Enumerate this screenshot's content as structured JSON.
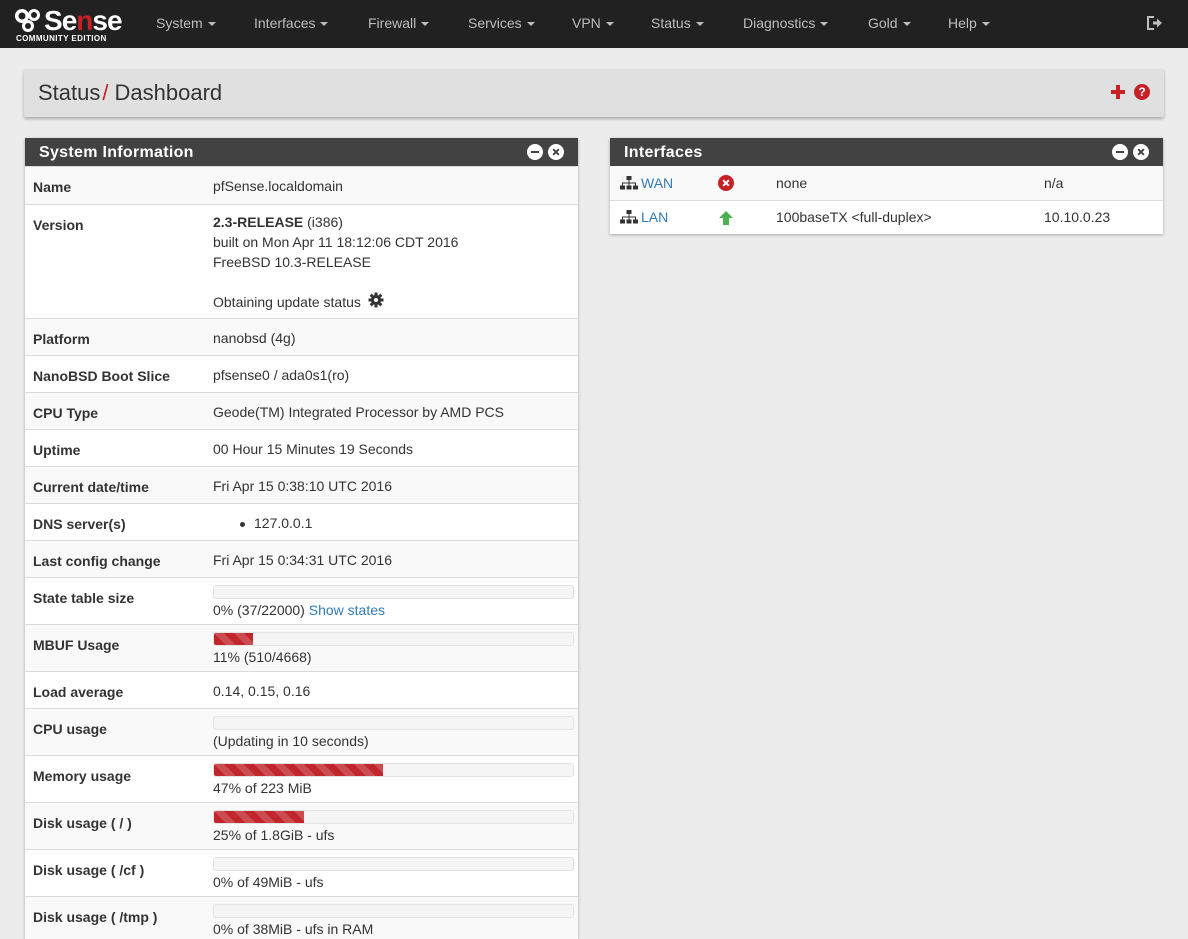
{
  "navbar": {
    "logo": {
      "text_main": "Sense",
      "text_sub": "COMMUNITY EDITION"
    },
    "menu": [
      {
        "label": "System"
      },
      {
        "label": "Interfaces"
      },
      {
        "label": "Firewall"
      },
      {
        "label": "Services"
      },
      {
        "label": "VPN"
      },
      {
        "label": "Status"
      },
      {
        "label": "Diagnostics"
      },
      {
        "label": "Gold"
      },
      {
        "label": "Help"
      }
    ],
    "logout_icon": "sign-out-icon"
  },
  "breadcrumb": {
    "section": "Status",
    "separator": "/",
    "page": "Dashboard",
    "icons": [
      "plus-icon",
      "question-circle-icon"
    ],
    "help_glyph": "?"
  },
  "system_info": {
    "title": "System Information",
    "rows": {
      "name": {
        "label": "Name",
        "value": "pfSense.localdomain"
      },
      "version": {
        "label": "Version",
        "release": "2.3-RELEASE",
        "arch": " (i386)",
        "built": "built on Mon Apr 11 18:12:06 CDT 2016",
        "os": "FreeBSD 10.3-RELEASE",
        "update_status": "Obtaining update status"
      },
      "platform": {
        "label": "Platform",
        "value": "nanobsd (4g)"
      },
      "boot_slice": {
        "label": "NanoBSD Boot Slice",
        "value": "pfsense0 / ada0s1(ro)"
      },
      "cpu_type": {
        "label": "CPU Type",
        "value": "Geode(TM) Integrated Processor by AMD PCS"
      },
      "uptime": {
        "label": "Uptime",
        "value": "00 Hour 15 Minutes 19 Seconds"
      },
      "datetime": {
        "label": "Current date/time",
        "value": "Fri Apr 15 0:38:10 UTC 2016"
      },
      "dns": {
        "label": "DNS server(s)",
        "servers": [
          "127.0.0.1"
        ]
      },
      "last_config": {
        "label": "Last config change",
        "value": "Fri Apr 15 0:34:31 UTC 2016"
      },
      "state_table": {
        "label": "State table size",
        "percent": 0,
        "value": "0% (37/22000)",
        "link": "Show states"
      },
      "mbuf": {
        "label": "MBUF Usage",
        "percent": 11,
        "value": "11% (510/4668)"
      },
      "load": {
        "label": "Load average",
        "value": "0.14, 0.15, 0.16"
      },
      "cpu_usage": {
        "label": "CPU usage",
        "percent": 0,
        "value": "(Updating in 10 seconds)"
      },
      "memory": {
        "label": "Memory usage",
        "percent": 47,
        "value": "47% of 223 MiB"
      },
      "disk_root": {
        "label": "Disk usage ( / )",
        "percent": 25,
        "value": "25% of 1.8GiB - ufs"
      },
      "disk_cf": {
        "label": "Disk usage ( /cf )",
        "percent": 0,
        "value": "0% of 49MiB - ufs"
      },
      "disk_tmp": {
        "label": "Disk usage ( /tmp )",
        "percent": 0,
        "value": "0% of 38MiB - ufs in RAM"
      }
    }
  },
  "interfaces": {
    "title": "Interfaces",
    "rows": [
      {
        "name": "WAN",
        "status": "down",
        "status_icon": "times-circle-icon",
        "media": "none",
        "ip": "n/a"
      },
      {
        "name": "LAN",
        "status": "up",
        "status_icon": "arrow-up-icon",
        "media": "100baseTX <full-duplex>",
        "ip": "10.10.0.23"
      }
    ]
  },
  "colors": {
    "brand_red": "#c72127",
    "navbar_bg": "#212121",
    "panel_head": "#424242",
    "link": "#337ab7",
    "status_up": "#4caf50"
  }
}
